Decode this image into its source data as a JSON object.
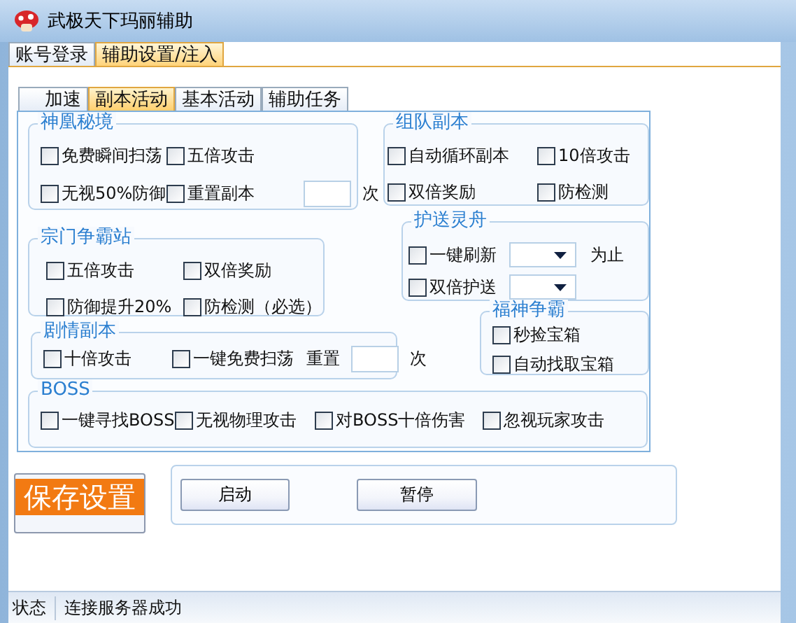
{
  "window": {
    "title": "武极天下玛丽辅助"
  },
  "outer_tabs": [
    {
      "label": "账号登录",
      "selected": false
    },
    {
      "label": "辅助设置/注入",
      "selected": true
    }
  ],
  "inner_tabs": [
    {
      "label": "加速",
      "selected": false
    },
    {
      "label": "副本活动",
      "selected": true
    },
    {
      "label": "基本活动",
      "selected": false
    },
    {
      "label": "辅助任务",
      "selected": false
    }
  ],
  "groups": [
    {
      "title": "神凰秘境",
      "rows": [
        [
          {
            "kind": "checkbox",
            "label": "免费瞬间扫荡",
            "checked": false
          },
          {
            "kind": "checkbox",
            "label": "五倍攻击",
            "checked": false
          }
        ],
        [
          {
            "kind": "checkbox",
            "label": "无视50%防御",
            "checked": false
          },
          {
            "kind": "checkbox",
            "label": "重置副本",
            "checked": false
          },
          {
            "kind": "field"
          },
          {
            "kind": "text",
            "label": "次"
          }
        ]
      ]
    },
    {
      "title": "组队副本",
      "rows": [
        [
          {
            "kind": "checkbox",
            "label": "自动循环副本",
            "checked": false
          },
          {
            "kind": "checkbox",
            "label": "10倍攻击",
            "checked": false
          }
        ],
        [
          {
            "kind": "checkbox",
            "label": "双倍奖励",
            "checked": false
          },
          {
            "kind": "checkbox",
            "label": "防检测",
            "checked": false
          }
        ]
      ]
    },
    {
      "title": "宗门争霸站",
      "rows": [
        [
          {
            "kind": "checkbox",
            "label": "五倍攻击",
            "checked": false
          },
          {
            "kind": "checkbox",
            "label": "双倍奖励",
            "checked": false
          }
        ],
        [
          {
            "kind": "checkbox",
            "label": "防御提升20%",
            "checked": false
          },
          {
            "kind": "checkbox",
            "label": "防检测（必选）",
            "checked": false
          }
        ]
      ]
    },
    {
      "title": "护送灵舟",
      "rows": [
        [
          {
            "kind": "checkbox",
            "label": "一键刷新",
            "checked": false
          },
          {
            "kind": "dropdown"
          },
          {
            "kind": "text",
            "label": "为止"
          }
        ],
        [
          {
            "kind": "checkbox",
            "label": "双倍护送",
            "checked": false
          },
          {
            "kind": "dropdown"
          }
        ]
      ]
    },
    {
      "title": "剧情副本",
      "rows": [
        [
          {
            "kind": "checkbox",
            "label": "十倍攻击",
            "checked": false
          },
          {
            "kind": "checkbox",
            "label": "一键免费扫荡",
            "checked": false
          },
          {
            "kind": "text",
            "label": "重置"
          },
          {
            "kind": "field"
          },
          {
            "kind": "text",
            "label": "次"
          }
        ]
      ]
    },
    {
      "title": "福神争霸",
      "rows": [
        [
          {
            "kind": "checkbox",
            "label": "秒捡宝箱",
            "checked": false
          }
        ],
        [
          {
            "kind": "checkbox",
            "label": "自动找取宝箱",
            "checked": false
          }
        ]
      ]
    },
    {
      "title": "BOSS",
      "rows": [
        [
          {
            "kind": "checkbox",
            "label": "一键寻找BOSS",
            "checked": false
          },
          {
            "kind": "checkbox",
            "label": "无视物理攻击",
            "checked": false
          },
          {
            "kind": "checkbox",
            "label": "对BOSS十倍伤害",
            "checked": false
          },
          {
            "kind": "checkbox",
            "label": "忽视玩家攻击",
            "checked": false
          }
        ]
      ]
    }
  ],
  "save_button": "保存设置",
  "action_buttons": [
    "启动",
    "暂停"
  ],
  "status_bar": {
    "label": "状态",
    "message": "连接服务器成功"
  }
}
